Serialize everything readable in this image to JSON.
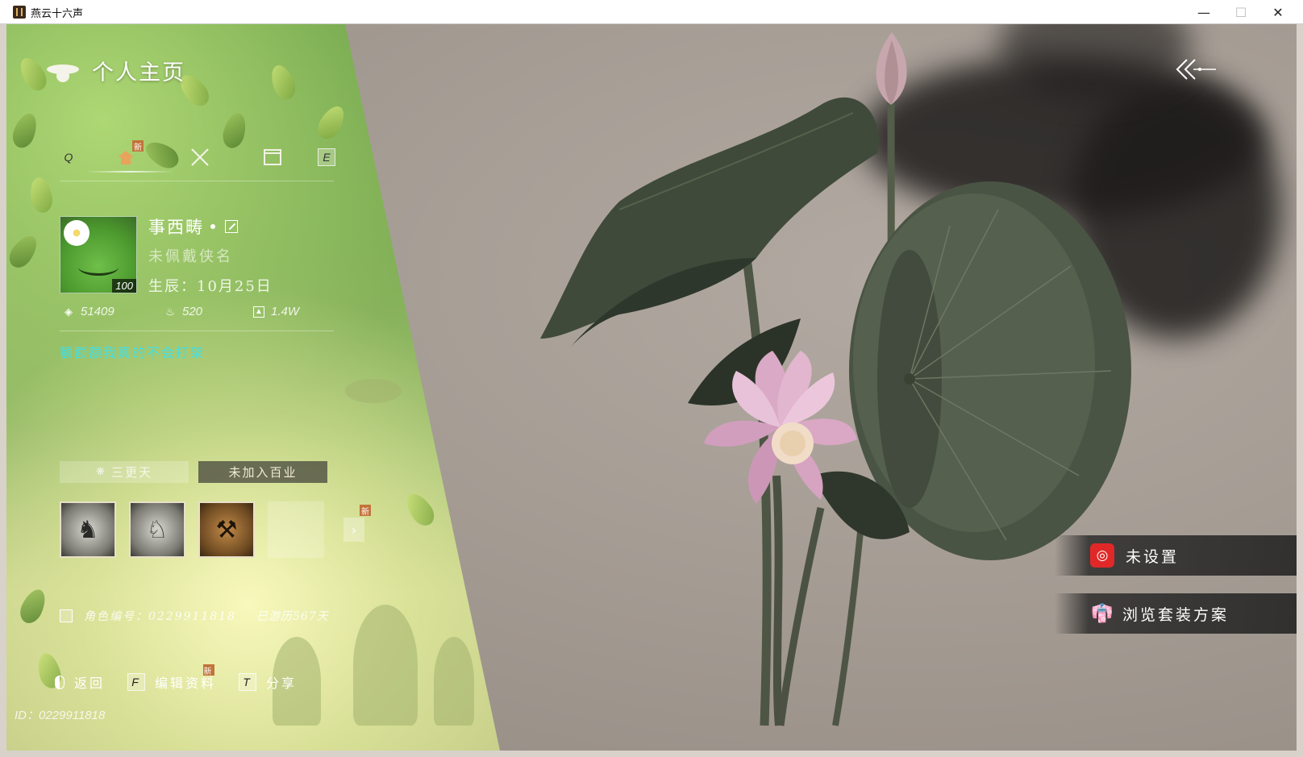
{
  "window": {
    "title": "燕云十六声",
    "minimize": "—",
    "maximize": "☐",
    "close": "✕"
  },
  "header": {
    "title": "个人主页"
  },
  "tabs": {
    "q_key": "Q",
    "e_key": "E",
    "new_tag": "新",
    "items": [
      {
        "icon": "house-icon"
      },
      {
        "icon": "crossed-swords-icon"
      },
      {
        "icon": "frame-icon"
      }
    ]
  },
  "profile": {
    "name": "事西畴",
    "title": "未佩戴侠名",
    "birthday": "生辰：10月25日",
    "level": "100",
    "stats": {
      "score": "51409",
      "heat": "520",
      "likes": "1.4W"
    },
    "signature": "额额额我真的不会打架"
  },
  "guild": {
    "guild_name": "三更天",
    "profession": "未加入百业"
  },
  "badges": {
    "new_tag": "新",
    "next": "›"
  },
  "ids": {
    "role_id": "角色编号：0229911818",
    "days": "已游历567天",
    "uid": "ID：0229911818"
  },
  "footer": {
    "back_label": "返回",
    "edit_key": "F",
    "edit_label": "编辑资料",
    "edit_new_tag": "新",
    "share_key": "T",
    "share_label": "分享"
  },
  "right": {
    "music_label": "未设置",
    "outfit_label": "浏览套装方案"
  },
  "colors": {
    "signature": "#40e0e8",
    "music_icon": "#e02828",
    "new_tag": "#c2743a"
  }
}
